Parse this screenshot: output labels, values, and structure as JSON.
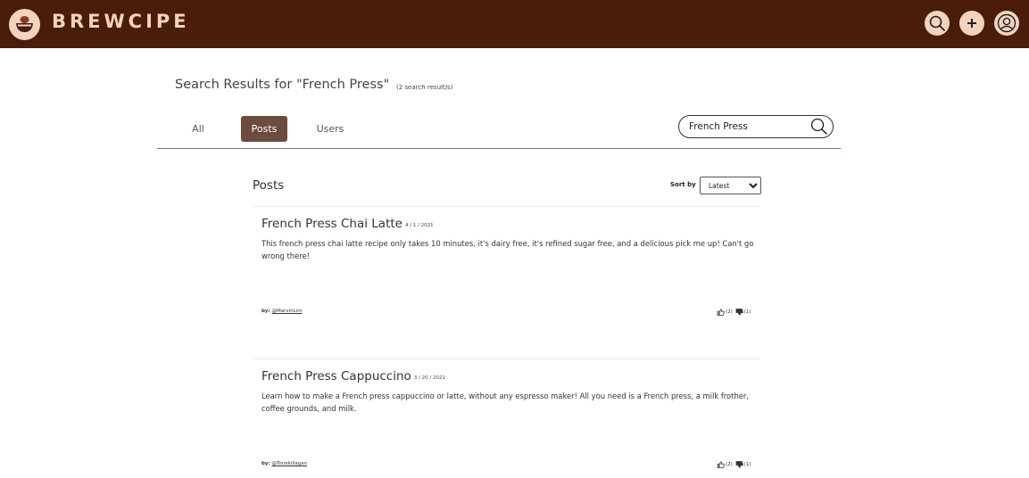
{
  "header": {
    "brand": "BREWCIPE",
    "colors": {
      "bar": "#4a1c0c",
      "accent": "#f3d3c0"
    },
    "icons": [
      "coffee-logo-icon",
      "search-icon",
      "plus-icon",
      "profile-icon"
    ]
  },
  "search": {
    "title": "Search Results for \"French Press\"",
    "count": "(2 search result/s)",
    "input_value": "French Press"
  },
  "tabs": [
    {
      "label": "All",
      "active": false
    },
    {
      "label": "Posts",
      "active": true
    },
    {
      "label": "Users",
      "active": false
    }
  ],
  "posts_section": {
    "heading": "Posts",
    "sort_label": "Sort by",
    "sort_selected": "Latest"
  },
  "posts": [
    {
      "title": "French Press Chai Latte",
      "date": "4 / 1 / 2021",
      "description": "This french press chai latte recipe only takes 10 minutes, it's dairy free, it's refined sugar free, and a delicious pick me up! Can't go wrong there!",
      "by_label": "by:",
      "author": "@MarvinLim",
      "likes": "(2)",
      "dislikes": "(1)"
    },
    {
      "title": "French Press Cappuccino",
      "date": "3 / 20 / 2021",
      "description": "Learn how to make a French press cappuccino or latte, without any espresso maker! All you need is a French press, a milk frother, coffee grounds, and milk.",
      "by_label": "by:",
      "author": "@Tonekillagan",
      "likes": "(2)",
      "dislikes": "(1)"
    }
  ]
}
